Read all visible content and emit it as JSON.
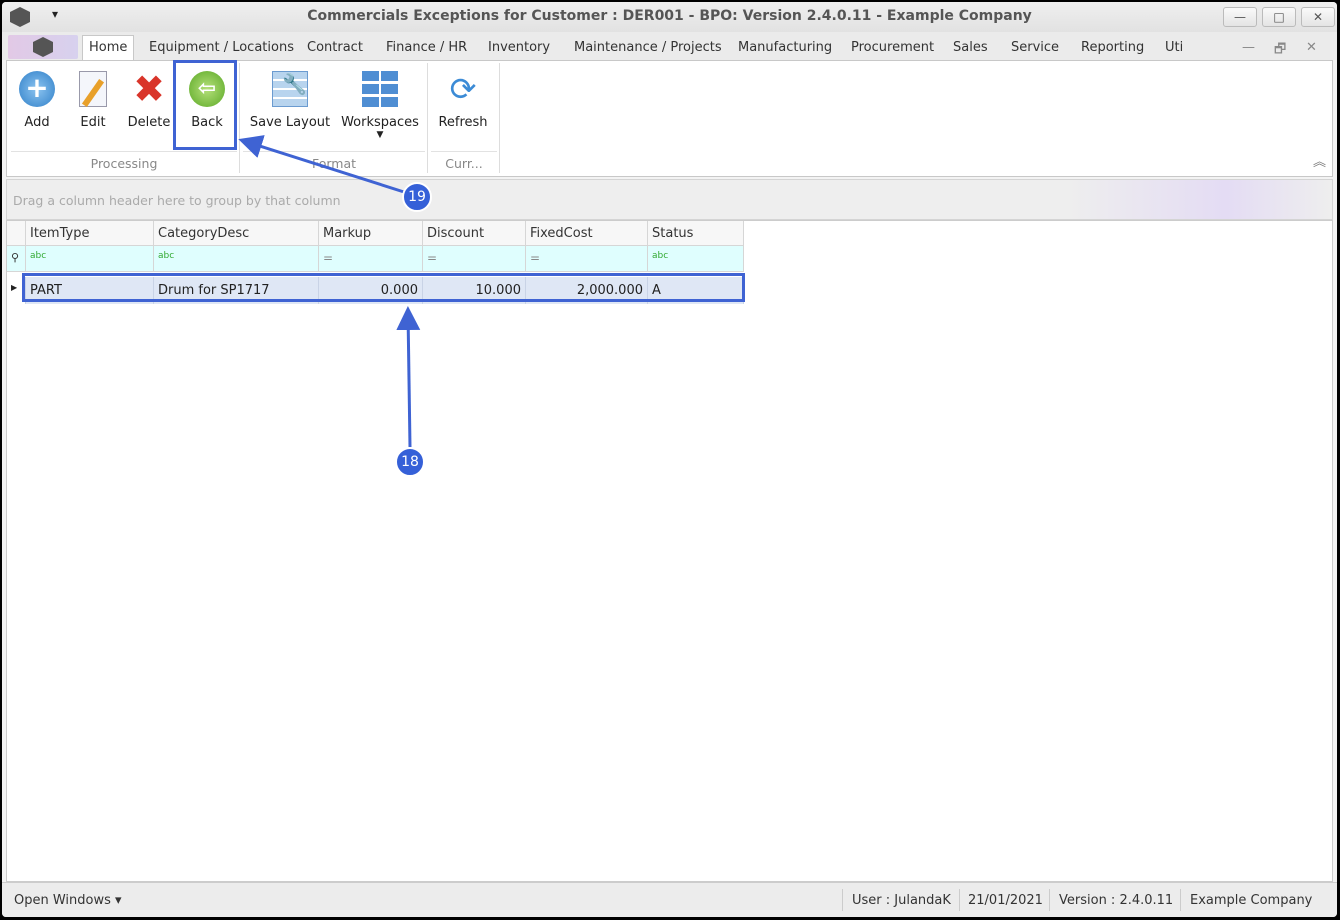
{
  "window": {
    "title": "Commercials Exceptions for Customer : DER001 - BPO: Version 2.4.0.11 - Example Company",
    "minimize": "—",
    "maximize": "□",
    "close": "✕",
    "qat_dropdown": "▾"
  },
  "tabs": [
    "Home",
    "Equipment / Locations",
    "Contract",
    "Finance / HR",
    "Inventory",
    "Maintenance / Projects",
    "Manufacturing",
    "Procurement",
    "Sales",
    "Service",
    "Reporting",
    "Uti"
  ],
  "mdi": {
    "minimize": "—",
    "restore": "🗗",
    "close": "✕"
  },
  "ribbon": {
    "buttons": {
      "add": "Add",
      "edit": "Edit",
      "delete": "Delete",
      "back": "Back",
      "save_layout": "Save Layout",
      "workspaces": "Workspaces",
      "refresh": "Refresh"
    },
    "groups": {
      "processing": "Processing",
      "format": "Format",
      "current": "Curr..."
    },
    "collapse": "︽"
  },
  "grid": {
    "group_hint": "Drag a column header here to group by that column",
    "columns": [
      "ItemType",
      "CategoryDesc",
      "Markup",
      "Discount",
      "FixedCost",
      "Status"
    ],
    "filter_icons": [
      "abc",
      "abc",
      "=",
      "=",
      "=",
      "abc"
    ],
    "rows": [
      {
        "ItemType": "PART",
        "CategoryDesc": "Drum for SP1717",
        "Markup": "0.000",
        "Discount": "10.000",
        "FixedCost": "2,000.000",
        "Status": "A"
      }
    ]
  },
  "statusbar": {
    "open_windows": "Open Windows ▾",
    "user": "User : JulandaK",
    "date": "21/01/2021",
    "version": "Version : 2.4.0.11",
    "company": "Example Company"
  },
  "annotations": {
    "back_step": "19",
    "row_step": "18",
    "color": "#3f63d3"
  }
}
